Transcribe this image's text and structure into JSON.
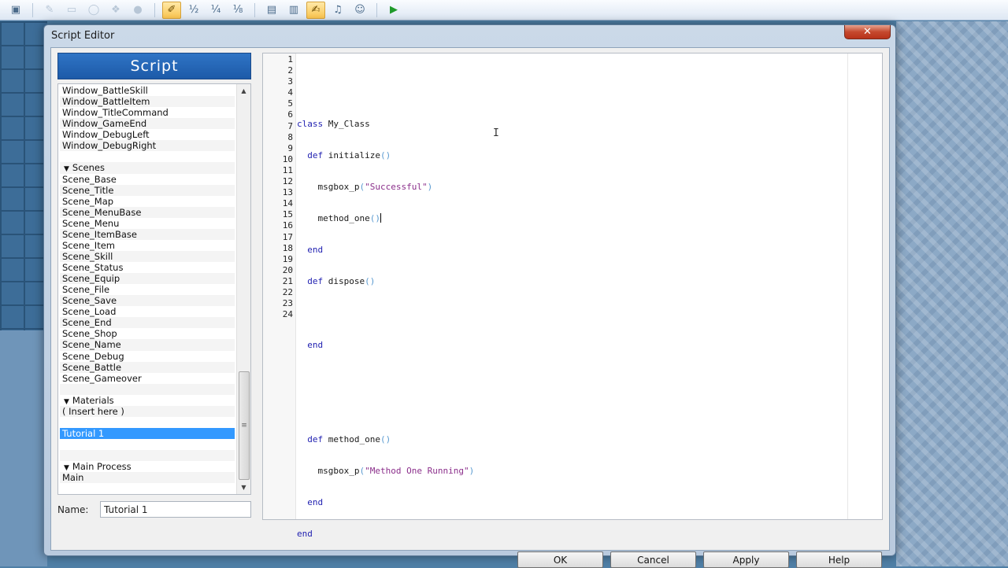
{
  "window": {
    "title": "Script Editor",
    "close_label": "✕"
  },
  "toolbar": {
    "icons": [
      "map-icon",
      "pencil-icon",
      "rectangle-icon",
      "ellipse-icon",
      "flood-fill-icon",
      "shadow-pen-icon",
      "event-layer-icon",
      "zoom-1-2-icon",
      "zoom-1-4-icon",
      "zoom-1-8-icon",
      "database-icon",
      "resource-manager-icon",
      "script-editor-icon",
      "sound-test-icon",
      "character-generator-icon",
      "playtest-icon"
    ],
    "glyphs": {
      "map": "▣",
      "pencil": "✎",
      "rect": "▭",
      "ellipse": "◯",
      "fill": "❖",
      "shadow": "●",
      "event": "✐",
      "z12": "½",
      "z14": "¼",
      "z18": "⅛",
      "db": "▤",
      "res": "▥",
      "script": "✍",
      "sound": "♫",
      "chargen": "☺",
      "play": "▶"
    }
  },
  "left_panel": {
    "header": "Script",
    "items": [
      {
        "label": "Window_BattleSkill"
      },
      {
        "label": "Window_BattleItem"
      },
      {
        "label": "Window_TitleCommand"
      },
      {
        "label": "Window_GameEnd"
      },
      {
        "label": "Window_DebugLeft"
      },
      {
        "label": "Window_DebugRight"
      },
      {
        "label": ""
      },
      {
        "label": "Scenes",
        "section": true
      },
      {
        "label": "Scene_Base"
      },
      {
        "label": "Scene_Title"
      },
      {
        "label": "Scene_Map"
      },
      {
        "label": "Scene_MenuBase"
      },
      {
        "label": "Scene_Menu"
      },
      {
        "label": "Scene_ItemBase"
      },
      {
        "label": "Scene_Item"
      },
      {
        "label": "Scene_Skill"
      },
      {
        "label": "Scene_Status"
      },
      {
        "label": "Scene_Equip"
      },
      {
        "label": "Scene_File"
      },
      {
        "label": "Scene_Save"
      },
      {
        "label": "Scene_Load"
      },
      {
        "label": "Scene_End"
      },
      {
        "label": "Scene_Shop"
      },
      {
        "label": "Scene_Name"
      },
      {
        "label": "Scene_Debug"
      },
      {
        "label": "Scene_Battle"
      },
      {
        "label": "Scene_Gameover"
      },
      {
        "label": ""
      },
      {
        "label": "Materials",
        "section": true
      },
      {
        "label": "( Insert here )"
      },
      {
        "label": ""
      },
      {
        "label": "Tutorial 1",
        "selected": true
      },
      {
        "label": ""
      },
      {
        "label": ""
      },
      {
        "label": "Main Process",
        "section": true
      },
      {
        "label": "Main"
      }
    ],
    "scroll_up": "▲",
    "scroll_down": "▼",
    "scroll_grip": "≡",
    "name_label": "Name:",
    "name_value": "Tutorial 1"
  },
  "editor": {
    "line_numbers": [
      "1",
      "2",
      "3",
      "4",
      "5",
      "6",
      "7",
      "8",
      "9",
      "10",
      "11",
      "12",
      "13",
      "14",
      "15",
      "16",
      "17",
      "18",
      "19",
      "20",
      "21",
      "22",
      "23",
      "24"
    ],
    "code": {
      "l5_kw": "class",
      "l5_name": " My_Class",
      "l6_kw": "  def",
      "l6_name": " initialize",
      "l6_p": "()",
      "l7_name": "    msgbox_p",
      "l7_po": "(",
      "l7_str": "\"Successful\"",
      "l7_pc": ")",
      "l8_name": "    method_one",
      "l8_p": "()",
      "l9_kw": "  end",
      "l10_kw": "  def",
      "l10_name": " dispose",
      "l10_p": "()",
      "l12_kw": "  end",
      "l15_kw": "  def",
      "l15_name": " method_one",
      "l15_p": "()",
      "l16_name": "    msgbox_p",
      "l16_po": "(",
      "l16_str": "\"Method One Running\"",
      "l16_pc": ")",
      "l17_kw": "  end",
      "l18_kw": "end"
    },
    "ibeam": "I"
  },
  "buttons": {
    "ok": "OK",
    "cancel": "Cancel",
    "apply": "Apply",
    "help": "Help"
  }
}
